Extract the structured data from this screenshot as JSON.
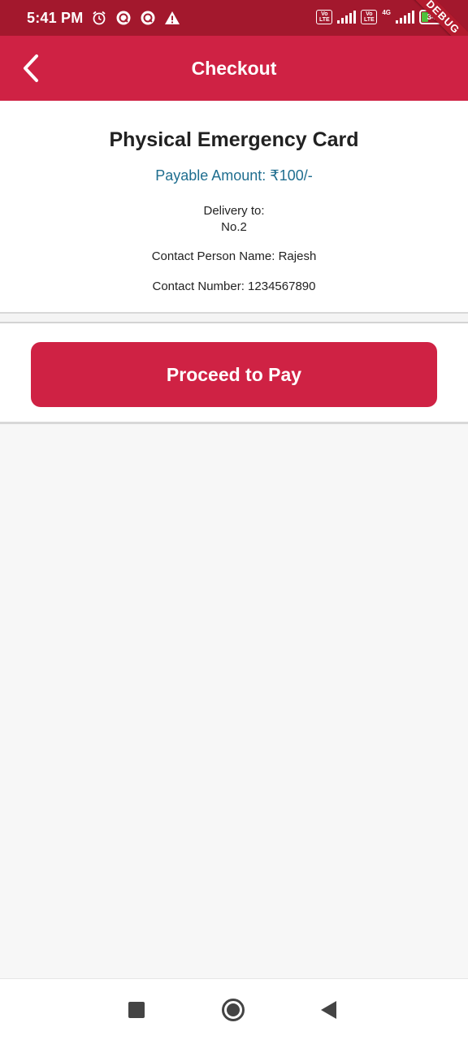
{
  "status_bar": {
    "time": "5:41 PM",
    "icons": [
      "alarm-icon",
      "notification-icon",
      "notification-icon",
      "warning-icon"
    ],
    "volte1": "Vo LTE",
    "volte2": "Vo LTE",
    "network_type": "4G",
    "battery_level": "34"
  },
  "debug_banner": "DEBUG",
  "app_bar": {
    "title": "Checkout",
    "back_icon": "chevron-left-icon"
  },
  "details": {
    "title": "Physical Emergency Card",
    "payable_amount": "Payable Amount: ₹100/-",
    "delivery_label": "Delivery to:",
    "delivery_value": "No.2",
    "contact_person": "Contact Person Name: Rajesh",
    "contact_number": "Contact Number: 1234567890"
  },
  "actions": {
    "proceed_label": "Proceed to Pay"
  },
  "nav_bar": {
    "icons": [
      "recents-icon",
      "home-icon",
      "back-icon"
    ]
  },
  "colors": {
    "primary": "#cf2244",
    "status_bar": "#a3182d",
    "amount_text": "#1f6e8f",
    "background": "#f7f7f7"
  }
}
